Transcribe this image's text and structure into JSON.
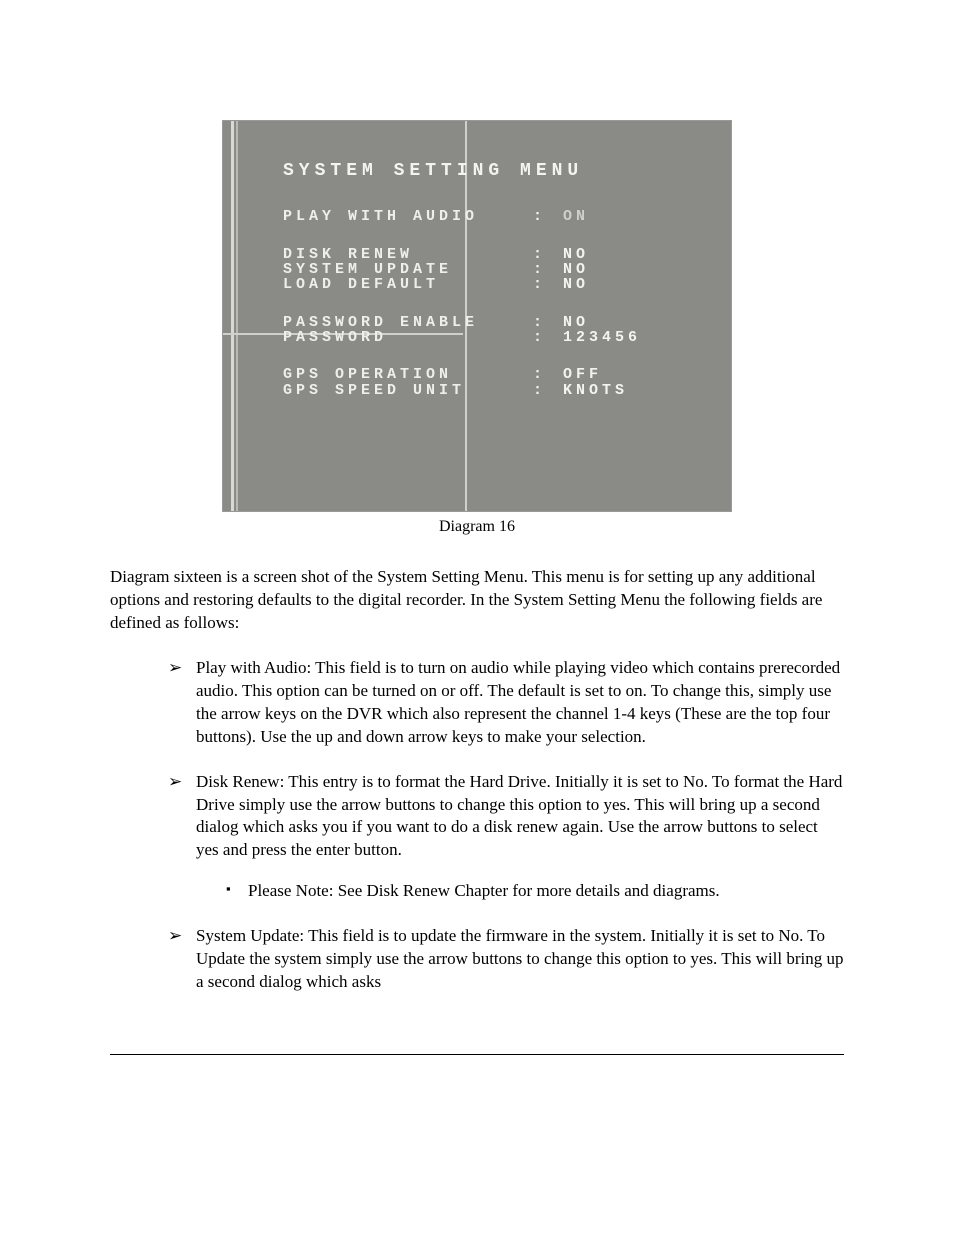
{
  "screenshot": {
    "title": "SYSTEM SETTING MENU",
    "groups": [
      {
        "rows": [
          {
            "label": "PLAY WITH AUDIO",
            "value": "ON",
            "dim": true
          }
        ]
      },
      {
        "tight": true,
        "rows": [
          {
            "label": "DISK RENEW",
            "value": "NO"
          },
          {
            "label": "SYSTEM UPDATE",
            "value": "NO"
          },
          {
            "label": "LOAD DEFAULT",
            "value": "NO"
          }
        ]
      },
      {
        "tight": true,
        "rows": [
          {
            "label": "PASSWORD ENABLE",
            "value": "NO"
          },
          {
            "label": "PASSWORD",
            "value": "123456"
          }
        ]
      },
      {
        "tight": true,
        "rows": [
          {
            "label": "GPS OPERATION",
            "value": "OFF"
          },
          {
            "label": "GPS SPEED UNIT",
            "value": "KNOTS"
          }
        ]
      }
    ]
  },
  "caption": "Diagram 16",
  "intro": "Diagram sixteen is a screen shot of the System Setting Menu. This menu is for setting up any additional options and restoring defaults to the digital recorder. In the System Setting Menu the following fields are defined as follows:",
  "bullets": [
    {
      "text": "Play with Audio: This field is to turn on audio while playing video which contains prerecorded audio. This option can be turned on or off. The default is set to on. To change this, simply use the arrow keys on the DVR which also represent the channel 1-4 keys (These are the top four buttons). Use the up and down arrow keys to make your selection."
    },
    {
      "text": "Disk Renew: This entry is to format the Hard Drive. Initially it is set to No. To format the Hard Drive simply use the arrow buttons to change this option to yes. This will bring up a second dialog which asks you if you want to do a disk renew again. Use the arrow buttons to select yes and press the enter button.",
      "sub": [
        "Please Note: See Disk Renew Chapter for more details and diagrams."
      ]
    },
    {
      "text": "System Update: This field is to update the firmware in the system. Initially it is set to No. To Update the system simply use the arrow buttons to change this option to yes. This will bring up a second dialog which asks"
    }
  ]
}
